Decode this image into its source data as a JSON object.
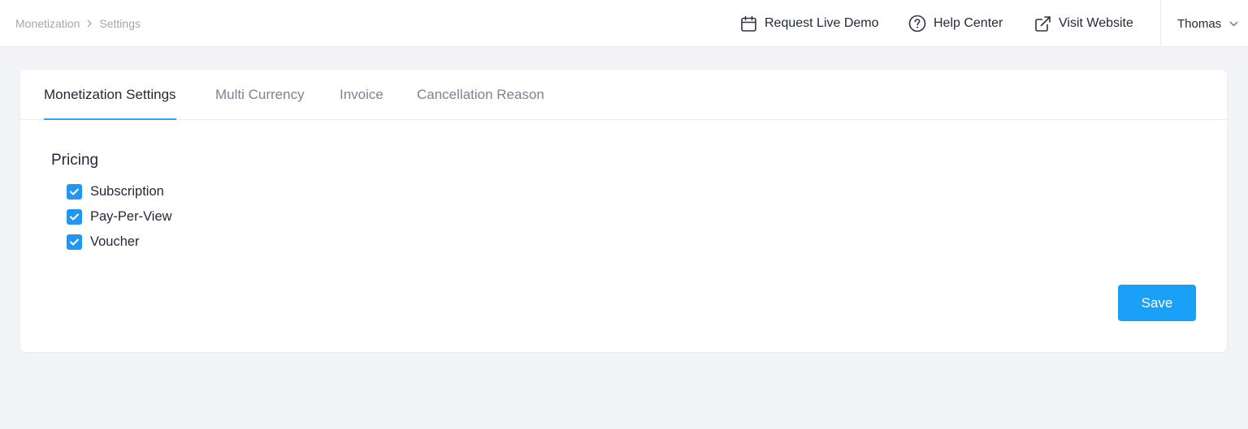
{
  "breadcrumb": {
    "items": [
      "Monetization",
      "Settings"
    ]
  },
  "header": {
    "actions": [
      {
        "label": "Request Live Demo",
        "icon": "calendar-icon"
      },
      {
        "label": "Help Center",
        "icon": "question-circle-icon"
      },
      {
        "label": "Visit Website",
        "icon": "external-link-icon"
      }
    ],
    "user": {
      "name": "Thomas",
      "icon": "chevron-down-icon"
    }
  },
  "tabs": [
    {
      "label": "Monetization Settings",
      "active": true
    },
    {
      "label": "Multi Currency",
      "active": false
    },
    {
      "label": "Invoice",
      "active": false
    },
    {
      "label": "Cancellation Reason",
      "active": false
    }
  ],
  "pricing": {
    "title": "Pricing",
    "options": [
      {
        "label": "Subscription",
        "checked": true
      },
      {
        "label": "Pay-Per-View",
        "checked": true
      },
      {
        "label": "Voucher",
        "checked": true
      }
    ]
  },
  "save_label": "Save",
  "colors": {
    "accent": "#1aa0f6",
    "checkbox": "#2196f3",
    "active_tab_underline": "#3aa0ea",
    "page_background": "#f3f4f8"
  }
}
